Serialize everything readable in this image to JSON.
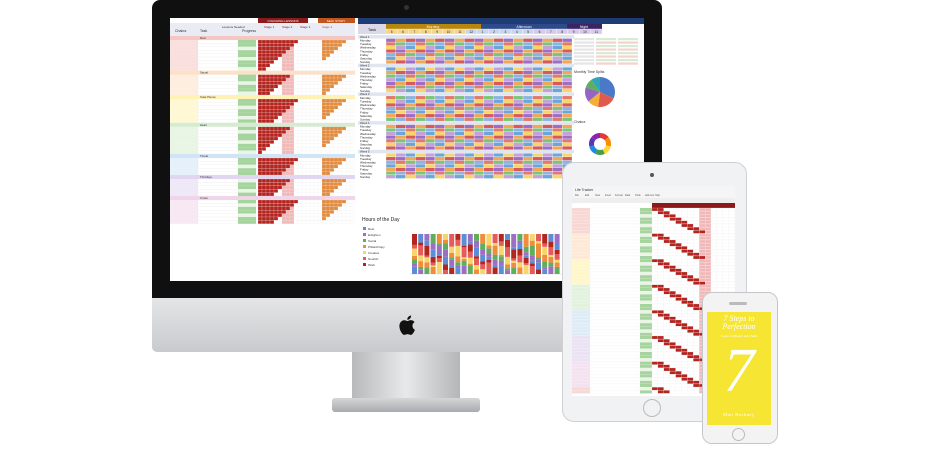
{
  "colors": {
    "header_maroon": "#8b1a1a",
    "cell_red": "#b5231e",
    "cell_orange": "#e38b3d",
    "cell_pink": "#f2b8b8",
    "cell_green": "#a6d49f",
    "screen_bg": "#ffffff",
    "book_yellow": "#f7e533"
  },
  "imac": {
    "left_sheet": {
      "header_groups": [
        "COACHING LESSONS",
        "SELF STUDY"
      ],
      "columns": [
        "Chakra",
        "Task",
        "Lessons Needed",
        "Progress"
      ],
      "stage_labels": [
        "Stage 1",
        "Stage 2",
        "Stage 3",
        "Stage 4"
      ],
      "section_labels": [
        "Root",
        "Sacral",
        "Solar Plexus",
        "Heart",
        "Throat",
        "Third Eye",
        "Crown"
      ]
    },
    "right_sheet": {
      "column_header": "Task",
      "period_labels": [
        "Morning",
        "Afternoon",
        "Night"
      ],
      "hours": [
        "5",
        "6",
        "7",
        "8",
        "9",
        "10",
        "11",
        "12",
        "1",
        "2",
        "3",
        "4",
        "5",
        "6",
        "7",
        "8",
        "9",
        "10",
        "11"
      ],
      "week_labels": [
        "Week 1",
        "Week 2",
        "Week 3",
        "Week 4",
        "Week 5"
      ],
      "days": [
        "Monday",
        "Tuesday",
        "Wednesday",
        "Thursday",
        "Friday",
        "Saturday",
        "Sunday"
      ],
      "chart_title": "Hours of the Day",
      "legend": [
        "Rest",
        "Enlighten",
        "Social",
        "Philanthropy",
        "Creative",
        "Nourish",
        "Work"
      ],
      "side_titles": [
        "Monthly Time Splits",
        "Chakra"
      ]
    }
  },
  "ipad": {
    "sheet_title": "Life Tracker",
    "menu": [
      "File",
      "Edit",
      "View",
      "Insert",
      "Format",
      "Data",
      "Tools",
      "Add-ons",
      "Help"
    ]
  },
  "iphone": {
    "book": {
      "line1": "7 Steps to Perfection",
      "subtitle": "Learn to Master Any Skill",
      "numeral": "7",
      "author": "Matt Hackney"
    }
  }
}
